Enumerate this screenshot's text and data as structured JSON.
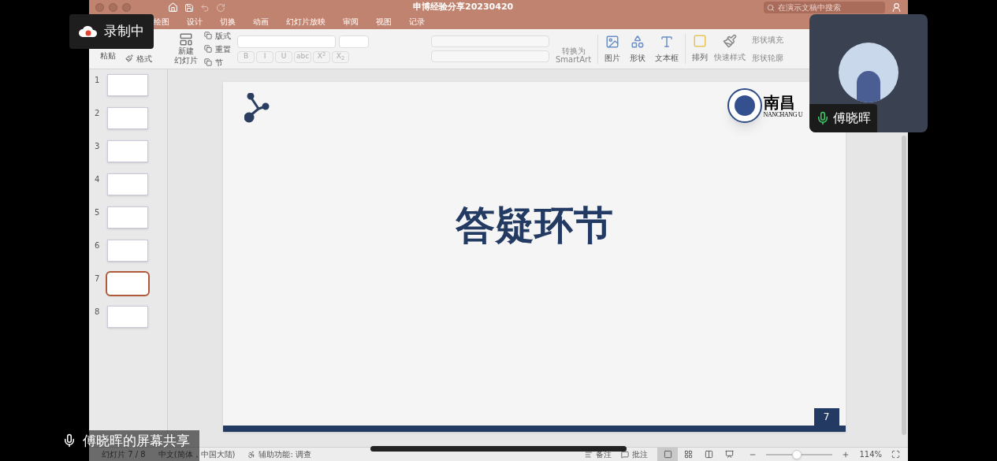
{
  "meeting": {
    "recording_label": "录制中",
    "participant": {
      "name": "傅晓晖",
      "mic_on": true
    },
    "share_label": "傅晓晖的屏幕共享"
  },
  "window": {
    "title": "申博经验分享20230420",
    "search_placeholder": "在演示文稿中搜索"
  },
  "tabs": [
    {
      "label": "绘图",
      "selected": false
    },
    {
      "label": "设计",
      "selected": false
    },
    {
      "label": "切换",
      "selected": false
    },
    {
      "label": "动画",
      "selected": false
    },
    {
      "label": "幻灯片放映",
      "selected": false
    },
    {
      "label": "审阅",
      "selected": false
    },
    {
      "label": "视图",
      "selected": false
    },
    {
      "label": "记录",
      "selected": false
    }
  ],
  "ribbon": {
    "paste": "粘贴",
    "format_painter": "格式",
    "new_slide": [
      "新建",
      "幻灯片"
    ],
    "layout": "版式",
    "reset": "重置",
    "section": "节",
    "font_buttons": [
      "B",
      "I",
      "U",
      "abc",
      "X$^{2}$",
      "X$_{2}$"
    ],
    "smartart": [
      "转换为",
      "SmartArt"
    ],
    "insert": [
      "图片",
      "形状",
      "文本框"
    ],
    "arrange": "排列",
    "quick_styles": "快速样式",
    "shape_fill": "形状填充",
    "shape_outline": "形状轮廓"
  },
  "slides": [
    {
      "number": "1",
      "selected": false
    },
    {
      "number": "2",
      "selected": false
    },
    {
      "number": "3",
      "selected": false
    },
    {
      "number": "4",
      "selected": false
    },
    {
      "number": "5",
      "selected": false
    },
    {
      "number": "6",
      "selected": false
    },
    {
      "number": "7",
      "selected": true
    },
    {
      "number": "8",
      "selected": false
    }
  ],
  "current_slide": {
    "title": "答疑环节",
    "page_number": "7",
    "logo_text": "南昌",
    "logo_subtext": "NANCHANG U"
  },
  "status_bar": {
    "slide_counter": "幻灯片 7 / 8",
    "language": "中文(简体，中国大陆)",
    "accessibility": "辅助功能: 调查",
    "notes": "备注",
    "comments": "批注",
    "views": [
      {
        "selected": true
      },
      {
        "selected": false
      },
      {
        "selected": false
      },
      {
        "selected": false
      }
    ],
    "zoom_slider": {
      "level": 0.45
    },
    "zoom": "114%"
  }
}
